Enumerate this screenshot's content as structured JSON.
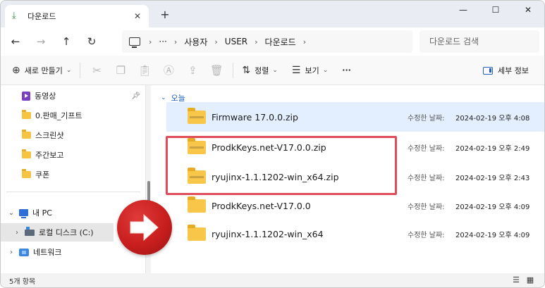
{
  "tab": {
    "icon": "download-icon",
    "label": "다운로드",
    "close": "✕",
    "new": "+"
  },
  "window_controls": {
    "minimize": "—",
    "maximize": "☐",
    "close": "✕"
  },
  "nav": {
    "back": "←",
    "forward": "→",
    "up": "↑",
    "refresh": "↻"
  },
  "address": {
    "more": "···",
    "segments": [
      "사용자",
      "USER",
      "다운로드"
    ]
  },
  "search": {
    "placeholder": "다운로드 검색"
  },
  "commands": {
    "new_label": "새로 만들기",
    "sort_label": "정렬",
    "view_label": "보기",
    "more": "···",
    "details_label": "세부 정보"
  },
  "sidebar": {
    "items": [
      {
        "label": "동영상",
        "icon": "video-icon"
      },
      {
        "label": "0.판매_기프트",
        "icon": "folder-icon"
      },
      {
        "label": "스크린샷",
        "icon": "folder-icon"
      },
      {
        "label": "주간보고",
        "icon": "folder-icon"
      },
      {
        "label": "쿠폰",
        "icon": "folder-icon"
      },
      {
        "label": "내 PC",
        "icon": "pc-icon"
      },
      {
        "label": "로컬 디스크 (C:)",
        "icon": "drive-icon"
      },
      {
        "label": "네트워크",
        "icon": "network-icon"
      }
    ]
  },
  "group": {
    "label": "오늘"
  },
  "files": [
    {
      "name": "Firmware 17.0.0.zip",
      "modified_label": "수정한 날짜:",
      "modified": "2024-02-19 오후 4:08"
    },
    {
      "name": "ProdkKeys.net-V17.0.0.zip",
      "modified_label": "수정한 날짜:",
      "modified": "2024-02-19 오후 2:49"
    },
    {
      "name": "ryujinx-1.1.1202-win_x64.zip",
      "modified_label": "수정한 날짜:",
      "modified": "2024-02-19 오후 2:43"
    },
    {
      "name": "ProdkKeys.net-V17.0.0",
      "modified_label": "수정한 날짜:",
      "modified": "2024-02-19 오후 4:09"
    },
    {
      "name": "ryujinx-1.1.1202-win_x64",
      "modified_label": "수정한 날짜:",
      "modified": "2024-02-19 오후 4:09"
    }
  ],
  "status": {
    "count": "5개 항목"
  },
  "colors": {
    "accent": "#1f5fbf",
    "highlight": "#e04c59",
    "badge": "#c81e1e",
    "folder": "#f8c74a"
  }
}
